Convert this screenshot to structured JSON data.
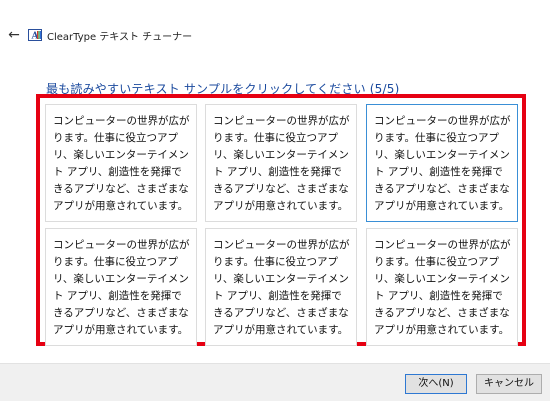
{
  "window": {
    "back_glyph": "←",
    "title": "ClearType テキスト チューナー"
  },
  "instruction": "最も読みやすいテキスト サンプルをクリックしてください (5/5)",
  "samples": [
    {
      "text": "コンピューターの世界が広がります。仕事に役立つアプリ、楽しいエンターテイメント アプリ、創造性を発揮できるアプリなど、さまざまなアプリが用意されています。",
      "selected": false
    },
    {
      "text": "コンピューターの世界が広がります。仕事に役立つアプリ、楽しいエンターテイメント アプリ、創造性を発揮できるアプリなど、さまざまなアプリが用意されています。",
      "selected": false
    },
    {
      "text": "コンピューターの世界が広がります。仕事に役立つアプリ、楽しいエンターテイメント アプリ、創造性を発揮できるアプリなど、さまざまなアプリが用意されています。",
      "selected": true
    },
    {
      "text": "コンピューターの世界が広がります。仕事に役立つアプリ、楽しいエンターテイメント アプリ、創造性を発揮できるアプリなど、さまざまなアプリが用意されています。",
      "selected": false
    },
    {
      "text": "コンピューターの世界が広がります。仕事に役立つアプリ、楽しいエンターテイメント アプリ、創造性を発揮できるアプリなど、さまざまなアプリが用意されています。",
      "selected": false
    },
    {
      "text": "コンピューターの世界が広がります。仕事に役立つアプリ、楽しいエンターテイメント アプリ、創造性を発揮できるアプリなど、さまざまなアプリが用意されています。",
      "selected": false
    }
  ],
  "footer": {
    "next_label": "次へ(N)",
    "cancel_label": "キャンセル"
  },
  "colors": {
    "highlight": "#e60012",
    "instruction": "#1b4a9e",
    "selected_border": "#3a8fd6"
  }
}
